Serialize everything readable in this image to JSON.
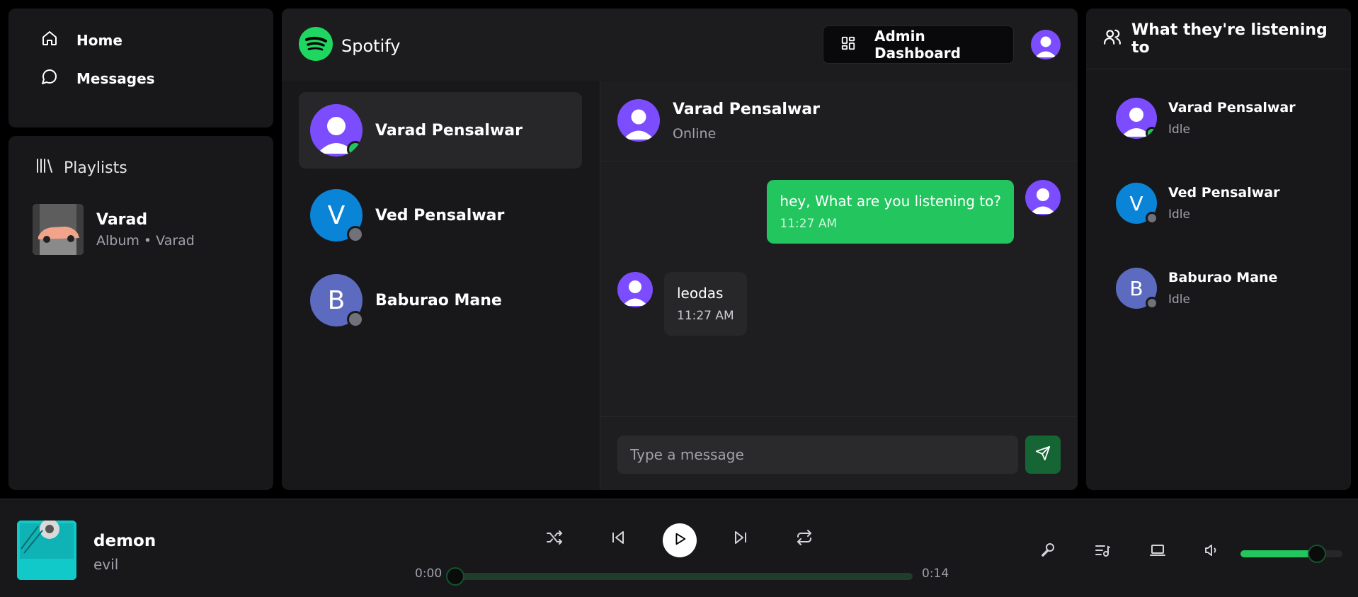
{
  "nav": {
    "items": [
      {
        "label": "Home",
        "icon": "home-icon"
      },
      {
        "label": "Messages",
        "icon": "message-icon"
      }
    ]
  },
  "library": {
    "title": "Playlists",
    "playlists": [
      {
        "title": "Varad",
        "subtitle": "Album • Varad"
      }
    ]
  },
  "header": {
    "brand": "Spotify",
    "admin_label": "Admin Dashboard"
  },
  "users": [
    {
      "name": "Varad Pensalwar",
      "initial": "",
      "status": "online",
      "avatar_color": "#7c4dff"
    },
    {
      "name": "Ved Pensalwar",
      "initial": "V",
      "status": "offline",
      "avatar_color": "#0a84d6"
    },
    {
      "name": "Baburao Mane",
      "initial": "B",
      "status": "offline",
      "avatar_color": "#5c6bc0"
    }
  ],
  "chat": {
    "name": "Varad Pensalwar",
    "status": "Online",
    "messages": [
      {
        "text": "hey, What are you listening to?",
        "time": "11:27 AM",
        "direction": "outgoing"
      },
      {
        "text": "leodas",
        "time": "11:27 AM",
        "direction": "incoming"
      }
    ],
    "input_placeholder": "Type a message"
  },
  "activity": {
    "title": "What they're listening to",
    "friends": [
      {
        "name": "Varad Pensalwar",
        "initial": "",
        "status_text": "Idle",
        "online": true
      },
      {
        "name": "Ved Pensalwar",
        "initial": "V",
        "status_text": "Idle",
        "online": false
      },
      {
        "name": "Baburao Mane",
        "initial": "B",
        "status_text": "Idle",
        "online": false
      }
    ]
  },
  "player": {
    "title": "demon",
    "artist": "evil",
    "current_time": "0:00",
    "duration": "0:14",
    "progress": 0.0,
    "volume": 0.75
  },
  "colors": {
    "accent": "#22c55e",
    "panel": "#18181b",
    "avatar_purple": "#7c4dff"
  }
}
